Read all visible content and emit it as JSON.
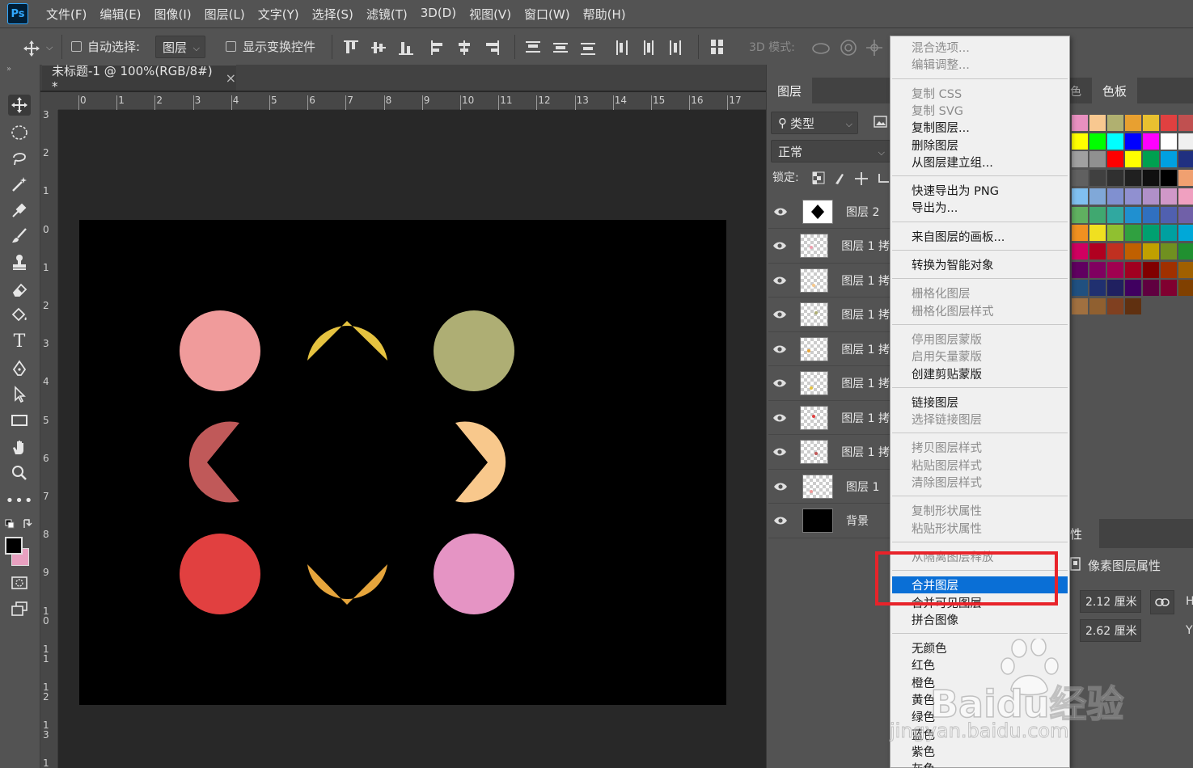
{
  "app": {
    "logo": "Ps"
  },
  "menubar": [
    "文件(F)",
    "编辑(E)",
    "图像(I)",
    "图层(L)",
    "文字(Y)",
    "选择(S)",
    "滤镜(T)",
    "3D(D)",
    "视图(V)",
    "窗口(W)",
    "帮助(H)"
  ],
  "options": {
    "auto_select_label": "自动选择:",
    "auto_select_target": "图层",
    "show_transform_label": "显示变换控件",
    "mode_3d_label": "3D 模式:"
  },
  "document": {
    "tab_title": "未标题-1 @ 100%(RGB/8#) *",
    "close": "×",
    "ruler_h": [
      "0",
      "1",
      "2",
      "3",
      "4",
      "5",
      "6",
      "7",
      "8",
      "9",
      "10",
      "11",
      "12",
      "13",
      "14",
      "15",
      "16",
      "17"
    ],
    "ruler_v": [
      "3",
      "2",
      "1",
      "0",
      "1",
      "2",
      "3",
      "4",
      "5",
      "6",
      "7",
      "8",
      "9",
      "1 0",
      "1 1",
      "1 2",
      "1 3",
      "1"
    ]
  },
  "shapes": {
    "colors": {
      "pink": "#f09b9b",
      "yellow_up": "#e6c340",
      "olive": "#aeae74",
      "rose": "#c05959",
      "peach": "#f8c88c",
      "red": "#e14040",
      "orange_down": "#e6a53c",
      "magenta": "#e594c4"
    }
  },
  "layers_panel": {
    "tab": "图层",
    "filter_label": "类型",
    "blend_mode": "正常",
    "lock_label": "锁定:",
    "layers": [
      {
        "name": "图层 2",
        "thumb": "diamond"
      },
      {
        "name": "图层 1 拷",
        "thumb_dot": "#f0a0b0"
      },
      {
        "name": "图层 1 拷",
        "thumb_dot": "#f8c88c"
      },
      {
        "name": "图层 1 拷",
        "thumb_dot": "#aeae74"
      },
      {
        "name": "图层 1 拷",
        "thumb_dot": "#e6a53c"
      },
      {
        "name": "图层 1 拷",
        "thumb_dot": "#e6c340"
      },
      {
        "name": "图层 1 拷",
        "thumb_dot": "#e14040"
      },
      {
        "name": "图层 1 拷",
        "thumb_dot": "#c05959"
      },
      {
        "name": "图层 1",
        "thumb_dot": "#f09b9b"
      },
      {
        "name": "背景",
        "thumb": "black"
      }
    ]
  },
  "swatches_panel": {
    "tab_partial": "色",
    "tab": "色板",
    "rows": [
      [
        "#e890c0",
        "#f8c890",
        "#b0b070",
        "#e8a030",
        "#e8c030",
        "#e04040",
        "#c05050"
      ],
      [
        "#ffff00",
        "#00ff00",
        "#00ffff",
        "#0000ff",
        "#ff00ff",
        "#ffffff",
        "#f0f0f0"
      ],
      [
        "#a0a0a0",
        "#909090",
        "#ff0000",
        "#ffff00",
        "#00a050",
        "#00a0e0",
        "#203080"
      ],
      [
        "#606060",
        "#404040",
        "#303030",
        "#202020",
        "#101010",
        "#000000",
        "#f0a070"
      ],
      [
        "#80c0f0",
        "#80a8d8",
        "#8090d0",
        "#9090d0",
        "#b090c8",
        "#d098c8",
        "#f0a0c0"
      ],
      [
        "#60b060",
        "#40a870",
        "#30a8a0",
        "#2090d0",
        "#3070c0",
        "#5060b0",
        "#7060a8"
      ],
      [
        "#f09020",
        "#f0e020",
        "#90c030",
        "#30a040",
        "#00a070",
        "#00a0a0",
        "#00a8d8"
      ],
      [
        "#d00060",
        "#b00020",
        "#c03020",
        "#c06000",
        "#c0a000",
        "#709020",
        "#209030"
      ],
      [
        "#600060",
        "#800060",
        "#a00050",
        "#a00020",
        "#800000",
        "#a03000",
        "#a06000"
      ],
      [
        "#205080",
        "#203070",
        "#202060",
        "#400060",
        "#600040",
        "#800030",
        "#804000"
      ],
      [
        "#a07040",
        "#906030",
        "#804020",
        "#603010"
      ]
    ]
  },
  "properties_panel": {
    "tab_partial": "性",
    "pixel_props": "像素图层属性",
    "width": "2.12 厘米",
    "height": "2.62 厘米",
    "h_label": "H",
    "y_label": "Y"
  },
  "context_menu": [
    {
      "label": "混合选项...",
      "disabled": true
    },
    {
      "label": "编辑调整...",
      "disabled": true
    },
    {
      "sep": true
    },
    {
      "label": "复制 CSS",
      "disabled": true
    },
    {
      "label": "复制 SVG",
      "disabled": true
    },
    {
      "label": "复制图层...",
      "disabled": false
    },
    {
      "label": "删除图层",
      "disabled": false
    },
    {
      "label": "从图层建立组...",
      "disabled": false
    },
    {
      "sep": true
    },
    {
      "label": "快速导出为 PNG",
      "disabled": false
    },
    {
      "label": "导出为...",
      "disabled": false
    },
    {
      "sep": true
    },
    {
      "label": "来自图层的画板...",
      "disabled": false
    },
    {
      "sep": true
    },
    {
      "label": "转换为智能对象",
      "disabled": false
    },
    {
      "sep": true
    },
    {
      "label": "栅格化图层",
      "disabled": true
    },
    {
      "label": "栅格化图层样式",
      "disabled": true
    },
    {
      "sep": true
    },
    {
      "label": "停用图层蒙版",
      "disabled": true
    },
    {
      "label": "启用矢量蒙版",
      "disabled": true
    },
    {
      "label": "创建剪贴蒙版",
      "disabled": false
    },
    {
      "sep": true
    },
    {
      "label": "链接图层",
      "disabled": false
    },
    {
      "label": "选择链接图层",
      "disabled": true
    },
    {
      "sep": true
    },
    {
      "label": "拷贝图层样式",
      "disabled": true
    },
    {
      "label": "粘贴图层样式",
      "disabled": true
    },
    {
      "label": "清除图层样式",
      "disabled": true
    },
    {
      "sep": true
    },
    {
      "label": "复制形状属性",
      "disabled": true
    },
    {
      "label": "粘贴形状属性",
      "disabled": true
    },
    {
      "sep": true
    },
    {
      "label": "从隔离图层释放",
      "disabled": true
    },
    {
      "sep": true
    },
    {
      "label": "合并图层",
      "disabled": false,
      "highlighted": true
    },
    {
      "label": "合并可见图层",
      "disabled": false
    },
    {
      "label": "拼合图像",
      "disabled": false
    },
    {
      "sep": true
    },
    {
      "label": "无颜色",
      "disabled": false
    },
    {
      "label": "红色",
      "disabled": false
    },
    {
      "label": "橙色",
      "disabled": false
    },
    {
      "label": "黄色",
      "disabled": false
    },
    {
      "label": "绿色",
      "disabled": false
    },
    {
      "label": "蓝色",
      "disabled": false
    },
    {
      "label": "紫色",
      "disabled": false
    },
    {
      "label": "灰色",
      "disabled": false
    }
  ],
  "watermark": {
    "text": "Baidu经验",
    "url": "jingyan.baidu.com"
  }
}
